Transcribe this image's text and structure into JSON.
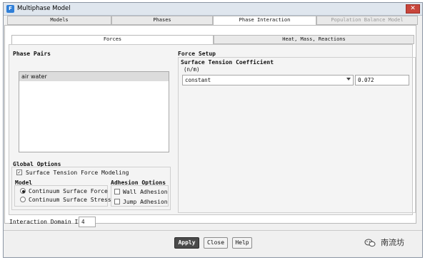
{
  "window": {
    "title": "Multiphase Model",
    "close_glyph": "✕"
  },
  "tabs": [
    {
      "label": "Models"
    },
    {
      "label": "Phases"
    },
    {
      "label": "Phase Interaction"
    },
    {
      "label": "Population Balance Model"
    }
  ],
  "sub_tabs": [
    {
      "label": "Forces"
    },
    {
      "label": "Heat, Mass, Reactions"
    }
  ],
  "phase_pairs": {
    "heading": "Phase Pairs",
    "items": [
      "air water"
    ]
  },
  "force_setup": {
    "heading": "Force Setup",
    "stc_title": "Surface Tension Coefficient",
    "stc_units": "(n/m)",
    "method_value": "constant",
    "coefficient_value": "0.072"
  },
  "global_options": {
    "heading": "Global Options",
    "surface_tension_modeling": {
      "label": "Surface Tension Force Modeling",
      "checked": true,
      "mark": "✓"
    },
    "model_heading": "Model",
    "model_options": [
      {
        "label": "Continuum Surface Force",
        "selected": true
      },
      {
        "label": "Continuum Surface Stress",
        "selected": false
      }
    ],
    "adhesion_heading": "Adhesion Options",
    "adhesion_options": [
      {
        "label": "Wall Adhesion",
        "checked": false
      },
      {
        "label": "Jump Adhesion",
        "checked": false
      }
    ]
  },
  "interaction_domain": {
    "label": "Interaction Domain ID",
    "value": "4"
  },
  "buttons": {
    "apply": "Apply",
    "close": "Close",
    "help": "Help"
  },
  "watermark": {
    "text": "南流坊",
    "icon": "wechat-icon"
  }
}
